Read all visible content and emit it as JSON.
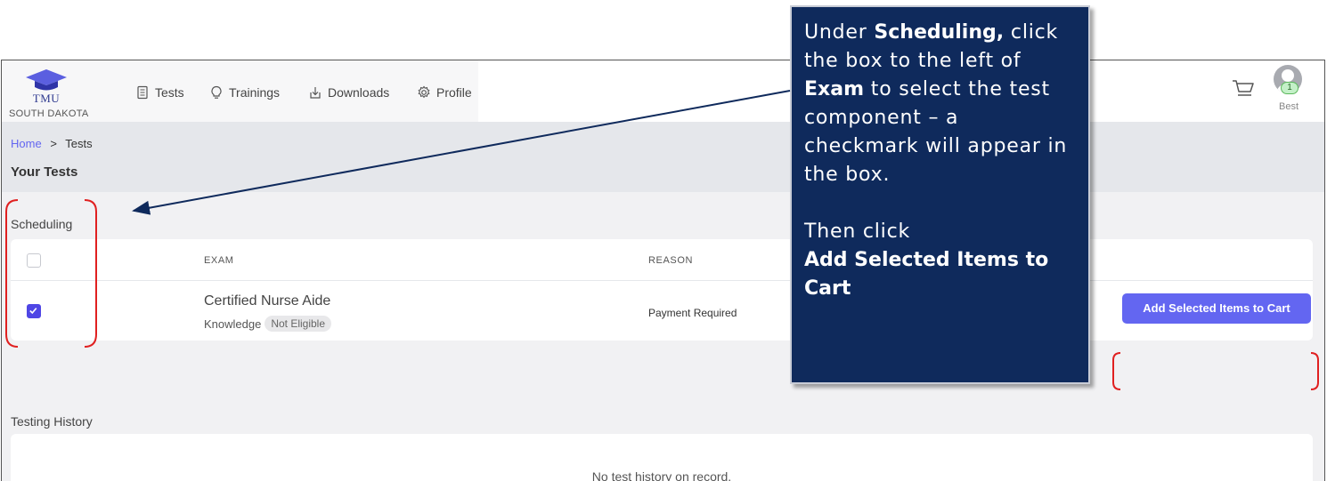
{
  "logo": {
    "name": "TMU",
    "state": "SOUTH DAKOTA"
  },
  "nav": [
    {
      "label": "Tests",
      "icon": "document-icon"
    },
    {
      "label": "Trainings",
      "icon": "lightbulb-icon"
    },
    {
      "label": "Downloads",
      "icon": "download-icon"
    },
    {
      "label": "Profile",
      "icon": "gear-icon"
    }
  ],
  "user": {
    "cart_count": "1",
    "name": "Best"
  },
  "breadcrumb": {
    "home": "Home",
    "separator": ">",
    "current": "Tests"
  },
  "page_title": "Your Tests",
  "scheduling": {
    "title": "Scheduling",
    "columns": {
      "exam": "EXAM",
      "reason": "REASON"
    },
    "rows": [
      {
        "exam": "Certified Nurse Aide",
        "component": "Knowledge",
        "status": "Not Eligible",
        "reason": "Payment Required",
        "checked": true
      }
    ]
  },
  "add_button": "Add Selected Items to Cart",
  "history": {
    "title": "Testing History",
    "empty": "No test history on record."
  },
  "callout": {
    "t1": "Under ",
    "b1": "Scheduling,",
    "t2": " click the box to the left of ",
    "b2": "Exam",
    "t3": " to select the test component – a checkmark will appear in the box.",
    "t4": "Then click",
    "b3": "Add Selected Items to Cart"
  },
  "colors": {
    "accent": "#6366f1",
    "callout_bg": "#0f2a5c",
    "annotation_red": "#e02020"
  }
}
